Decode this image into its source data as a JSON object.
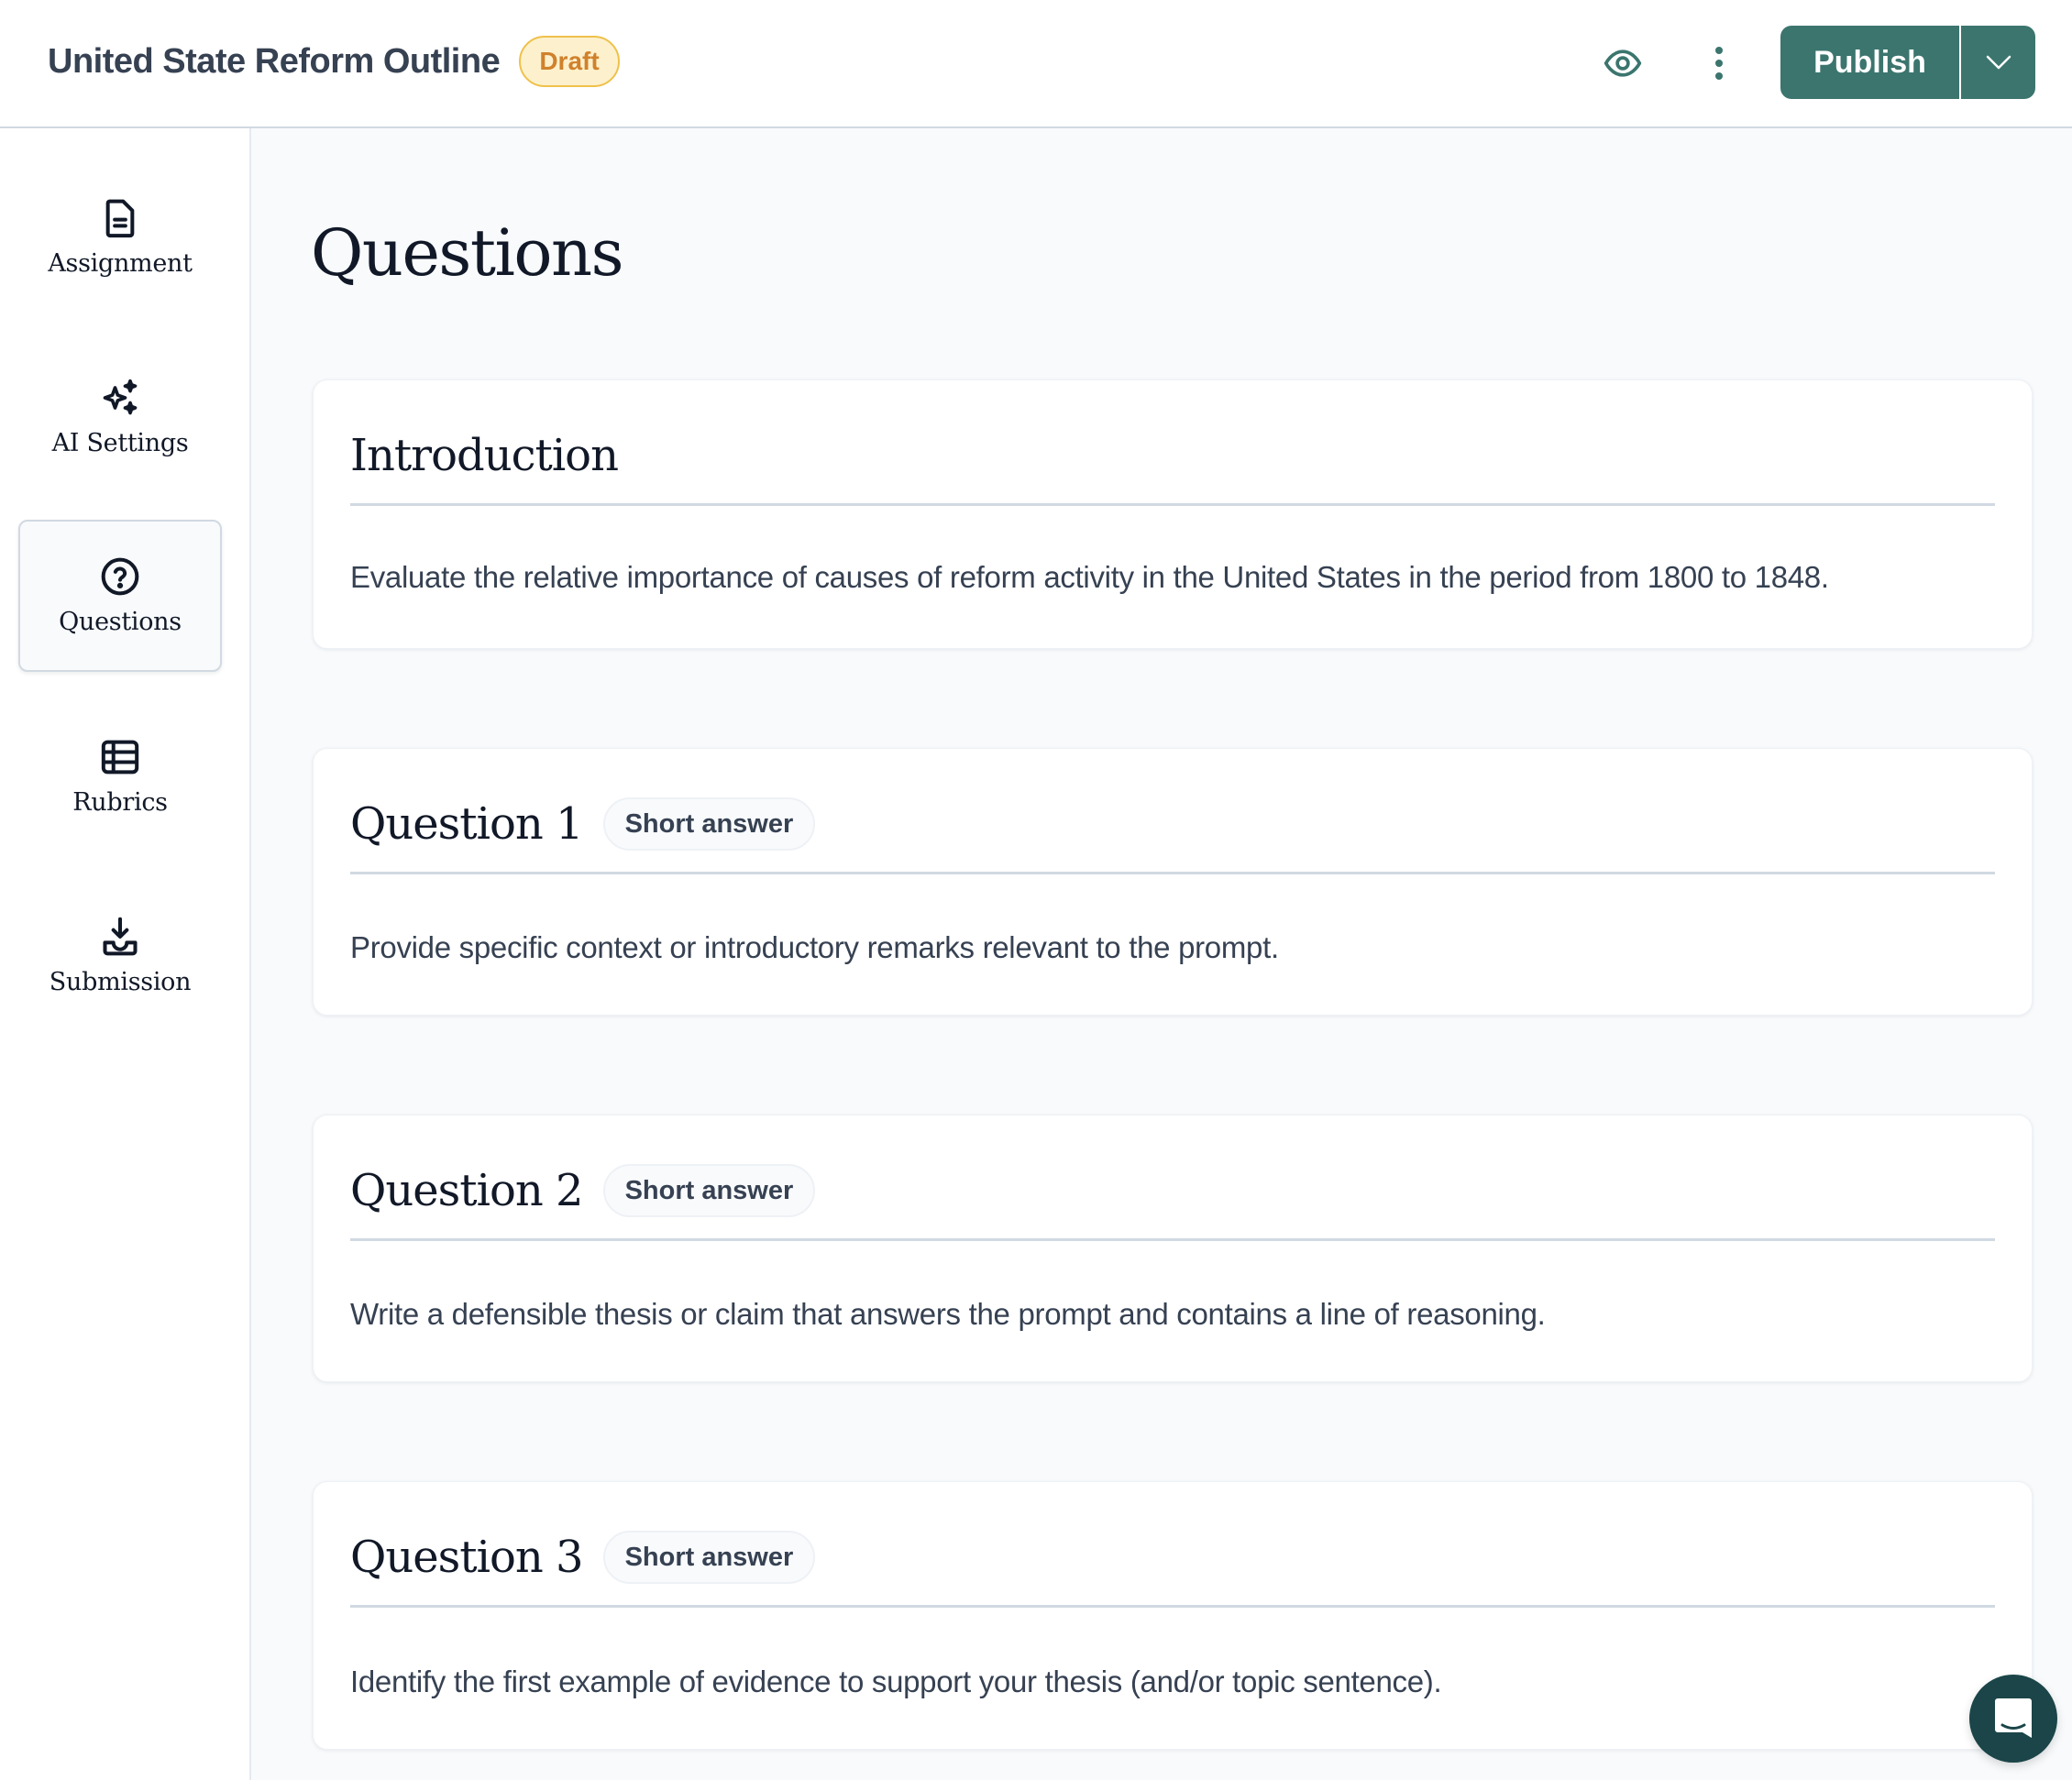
{
  "header": {
    "title": "United State Reform Outline",
    "status_badge": "Draft",
    "preview_icon": "eye-icon",
    "more_icon": "more-vertical-icon",
    "publish_label": "Publish",
    "publish_menu_icon": "chevron-down-icon"
  },
  "sidebar": {
    "items": [
      {
        "label": "Assignment",
        "icon": "document-icon",
        "active": false
      },
      {
        "label": "AI Settings",
        "icon": "sparkles-icon",
        "active": false
      },
      {
        "label": "Questions",
        "icon": "question-circle-icon",
        "active": true
      },
      {
        "label": "Rubrics",
        "icon": "table-icon",
        "active": false
      },
      {
        "label": "Submission",
        "icon": "download-tray-icon",
        "active": false
      }
    ]
  },
  "main": {
    "title": "Questions",
    "cards": [
      {
        "heading": "Introduction",
        "badge": null,
        "body": "Evaluate the relative importance of causes of reform activity in the United States in the period from 1800 to 1848."
      },
      {
        "heading": "Question 1",
        "badge": "Short answer",
        "body": "Provide specific context or introductory remarks relevant to the prompt."
      },
      {
        "heading": "Question 2",
        "badge": "Short answer",
        "body": "Write a defensible thesis or claim that answers the prompt and contains a line of reasoning."
      },
      {
        "heading": "Question 3",
        "badge": "Short answer",
        "body": "Identify the first example of evidence to support your thesis (and/or topic sentence)."
      }
    ]
  },
  "chat": {
    "icon": "chat-bubble-icon"
  },
  "colors": {
    "brand": "#3b756e",
    "chat": "#1b4548",
    "draft_text": "#d0812c",
    "draft_bg": "#fdf1cd",
    "draft_border": "#efc14b"
  }
}
